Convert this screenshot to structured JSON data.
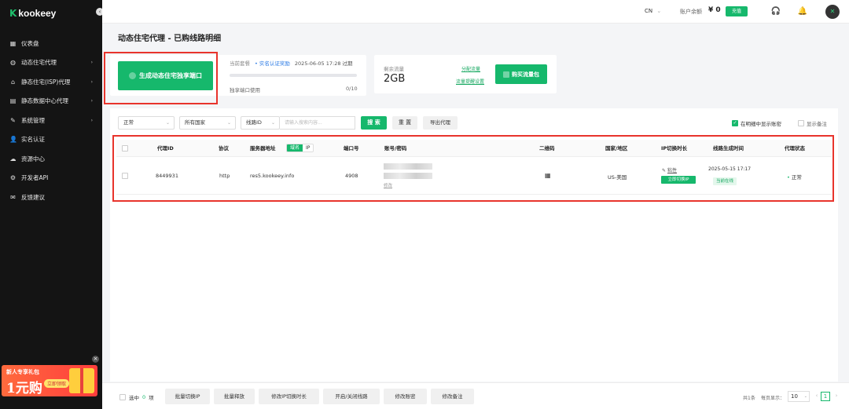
{
  "brand": {
    "name": "kookeey",
    "mark": "K",
    "collapse_glyph": "‹"
  },
  "sidebar": {
    "items": [
      {
        "label": "仪表盘",
        "icon": "dashboard-icon",
        "glyph": "▦",
        "arrow": ""
      },
      {
        "label": "动态住宅代理",
        "icon": "globe-icon",
        "glyph": "◍",
        "arrow": "›"
      },
      {
        "label": "静态住宅(ISP)代理",
        "icon": "home-icon",
        "glyph": "⌂",
        "arrow": "›"
      },
      {
        "label": "静态数据中心代理",
        "icon": "server-icon",
        "glyph": "▤",
        "arrow": "›"
      },
      {
        "label": "系统管理",
        "icon": "edit-icon",
        "glyph": "✎",
        "arrow": "›"
      },
      {
        "label": "实名认证",
        "icon": "user-icon",
        "glyph": "👤",
        "arrow": ""
      },
      {
        "label": "资源中心",
        "icon": "resource-icon",
        "glyph": "☁",
        "arrow": ""
      },
      {
        "label": "开发者API",
        "icon": "api-icon",
        "glyph": "⚙",
        "arrow": ""
      },
      {
        "label": "反馈建议",
        "icon": "feedback-icon",
        "glyph": "✉",
        "arrow": ""
      }
    ],
    "promo": {
      "line1": "新人专享礼包",
      "big": "1元购",
      "button": "立即领取",
      "close_glyph": "×"
    }
  },
  "header": {
    "lang": "CN",
    "lang_caret": "⌄",
    "balance_label": "账户余额",
    "balance": "¥ 0",
    "recharge": "充值",
    "headset_glyph": "🎧",
    "bell_glyph": "🔔",
    "avatar_glyph": "✕"
  },
  "page": {
    "title": "动态住宅代理 - 已购线路明细"
  },
  "summary": {
    "generate_btn": "生成动态住宅独享端口",
    "pkg_label": "当前套餐",
    "realname_reward": "实名认证奖励",
    "expire": "2025-06-05 17:28 过期",
    "port_usage_label": "独享端口使用",
    "port_usage_value": "0/10",
    "port_usage_fraction": 0
  },
  "traffic": {
    "remaining_label": "剩余流量",
    "remaining_value": "2GB",
    "allocate_link": "分配流量",
    "alert_link": "流量提醒设置",
    "buy_btn": "购买流量包"
  },
  "filters": {
    "status": "正常",
    "country": "所有国家",
    "field": "线路ID",
    "caret": "⌄",
    "search_placeholder": "请输入搜索内容...",
    "search_btn": "搜 索",
    "reset_btn": "重 置",
    "export_btn": "导出代理",
    "show_password": "在明细中显示账密",
    "show_note": "显示备注",
    "check_glyph": "✓"
  },
  "table": {
    "headers": {
      "proxy_id": "代理ID",
      "protocol": "协议",
      "server": "服务器地址",
      "toggle_domain": "域名",
      "toggle_ip": "IP",
      "port": "端口号",
      "account": "账号/密码",
      "qr": "二维码",
      "country": "国家/地区",
      "ip_switch": "IP切换时长",
      "created": "线路生成时间",
      "status": "代理状态"
    },
    "rows": [
      {
        "proxy_id": "8449931",
        "protocol": "http",
        "server": "res5.kookeey.info",
        "port": "4908",
        "edit": "修改",
        "qr_glyph": "▦",
        "country": "US-美国",
        "ip_mode": "粘性",
        "ip_mode_glyph": "✎",
        "switch_btn": "立即切换IP",
        "created": "2025-05-15 17:17",
        "online": "当前在线",
        "status": "正常",
        "status_dot": "•"
      }
    ]
  },
  "bottom": {
    "selected_prefix": "选中",
    "selected_count": "0",
    "selected_suffix": "项",
    "buttons": [
      "批量切换IP",
      "批量释放",
      "修改IP切换时长",
      "开启/关闭线路",
      "修改账密",
      "修改备注"
    ],
    "total": "共1条",
    "per_page_label": "每页显示：",
    "per_page": "10",
    "per_page_caret": "⌄",
    "prev": "‹",
    "page": "1",
    "next": "›"
  }
}
